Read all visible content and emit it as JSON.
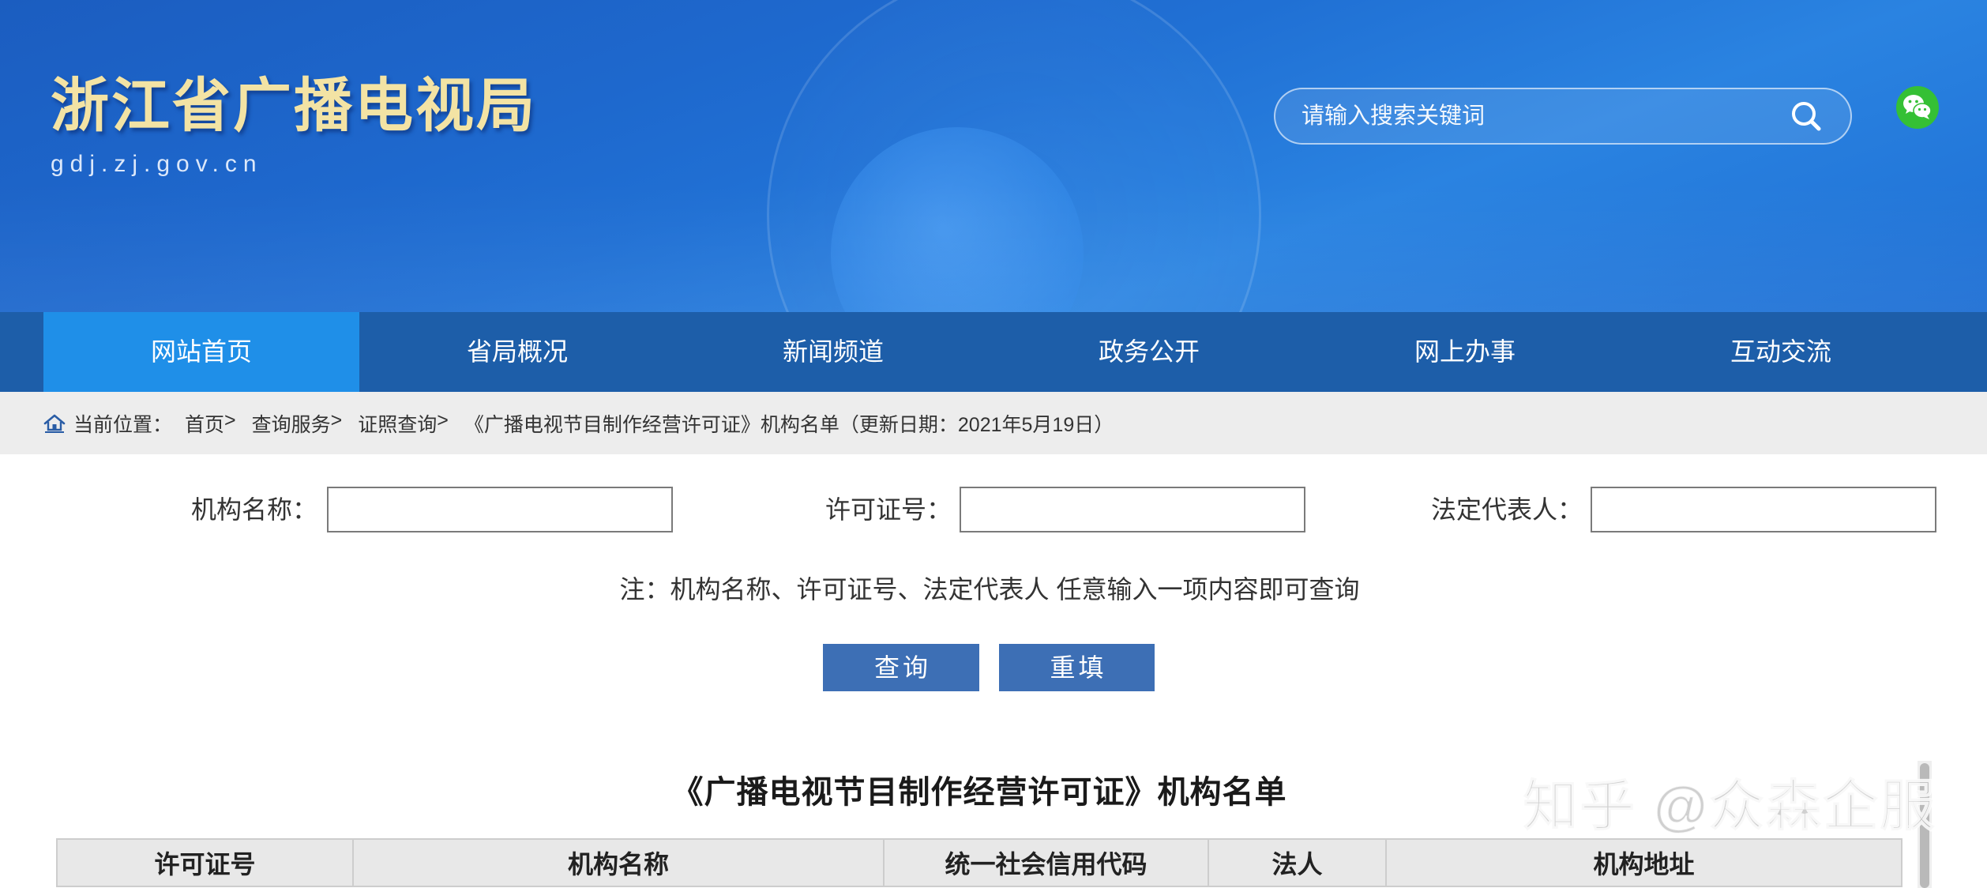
{
  "colors": {
    "header_blue": "#2070d4",
    "nav_blue": "#1d5ea9",
    "nav_active": "#1f8fe8",
    "crumb_bg": "#ededed",
    "button_blue": "#3d6fb5",
    "title_gold": "#f3e3a4",
    "wechat_green": "#35c035",
    "home_icon_blue": "#2a5da6"
  },
  "header": {
    "site_title": "浙江省广播电视局",
    "site_domain": "gdj.zj.gov.cn",
    "search": {
      "placeholder": "请输入搜索关键词",
      "icon": "search-icon"
    },
    "wechat": {
      "icon": "wechat-icon"
    }
  },
  "nav": {
    "items": [
      {
        "label": "网站首页",
        "active": true
      },
      {
        "label": "省局概况",
        "active": false
      },
      {
        "label": "新闻频道",
        "active": false
      },
      {
        "label": "政务公开",
        "active": false
      },
      {
        "label": "网上办事",
        "active": false
      },
      {
        "label": "互动交流",
        "active": false
      }
    ]
  },
  "breadcrumb": {
    "icon": "home-icon",
    "prefix": "当前位置：",
    "separator": ">",
    "links": [
      {
        "label": "首页"
      },
      {
        "label": "查询服务"
      },
      {
        "label": "证照查询"
      }
    ],
    "current": "《广播电视节目制作经营许可证》机构名单（更新日期：2021年5月19日）"
  },
  "search_form": {
    "fields": [
      {
        "label": "机构名称：",
        "value": ""
      },
      {
        "label": "许可证号：",
        "value": ""
      },
      {
        "label": "法定代表人：",
        "value": ""
      }
    ],
    "note": "注：机构名称、许可证号、法定代表人 任意输入一项内容即可查询",
    "query_button": "查询",
    "reset_button": "重填"
  },
  "results": {
    "title": "《广播电视节目制作经营许可证》机构名单",
    "columns": [
      "许可证号",
      "机构名称",
      "统一社会信用代码",
      "法人",
      "机构地址"
    ]
  },
  "watermark": "知乎 @众森企服"
}
